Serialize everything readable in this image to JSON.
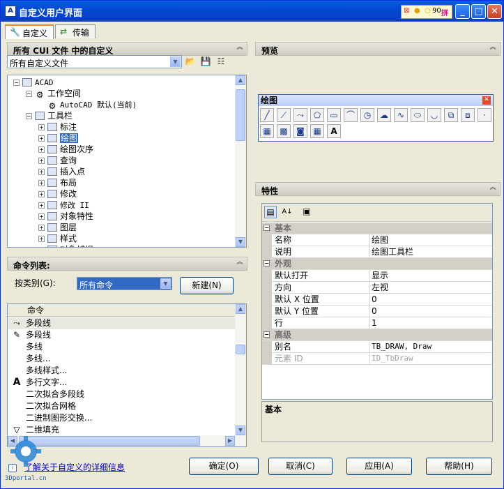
{
  "window": {
    "title": "自定义用户界面",
    "ime_text": "拼",
    "ime_mode": "90"
  },
  "tabs": [
    {
      "label": "自定义"
    },
    {
      "label": "传输"
    }
  ],
  "cui_panel": {
    "title": "所有 CUI 文件 中的自定义",
    "combo_value": "所有自定义文件",
    "tree": [
      {
        "label": "ACAD",
        "level": 0,
        "expanded": true
      },
      {
        "label": "工作空间",
        "level": 1,
        "expanded": true
      },
      {
        "label": "AutoCAD 默认(当前)",
        "level": 2
      },
      {
        "label": "工具栏",
        "level": 1,
        "expanded": true
      },
      {
        "label": "标注",
        "level": 2
      },
      {
        "label": "绘图",
        "level": 2,
        "selected": true
      },
      {
        "label": "绘图次序",
        "level": 2
      },
      {
        "label": "查询",
        "level": 2
      },
      {
        "label": "插入点",
        "level": 2
      },
      {
        "label": "布局",
        "level": 2
      },
      {
        "label": "修改",
        "level": 2
      },
      {
        "label": "修改 II",
        "level": 2
      },
      {
        "label": "对象特性",
        "level": 2
      },
      {
        "label": "图层",
        "level": 2
      },
      {
        "label": "样式",
        "level": 2
      },
      {
        "label": "对象捕捉",
        "level": 2
      }
    ]
  },
  "command_panel": {
    "title": "命令列表:",
    "filter_label": "按类别(G):",
    "filter_value": "所有命令",
    "new_button": "新建(N)",
    "column_header": "命令",
    "commands": [
      {
        "label": "多段线",
        "icon": "polyline-icon",
        "selected": true
      },
      {
        "label": "多段线",
        "icon": "pencil-icon"
      },
      {
        "label": "多线",
        "icon": ""
      },
      {
        "label": "多线...",
        "icon": ""
      },
      {
        "label": "多线样式...",
        "icon": ""
      },
      {
        "label": "多行文字...",
        "icon": "text-A-icon"
      },
      {
        "label": "二次拟合多段线",
        "icon": ""
      },
      {
        "label": "二次拟合网格",
        "icon": ""
      },
      {
        "label": "二进制图形交换...",
        "icon": ""
      },
      {
        "label": "二维填充",
        "icon": "fill-icon"
      }
    ]
  },
  "preview_panel": {
    "title": "预览",
    "toolbar_title": "绘图",
    "tools_row1": [
      "line-icon",
      "ray-icon",
      "polyline-icon",
      "polygon-icon",
      "rectangle-icon",
      "arc-icon",
      "circle-icon",
      "revcloud-icon",
      "spline-icon",
      "ellipse-icon",
      "ellipse-arc-icon",
      "insert-block-icon",
      "make-block-icon",
      "point-icon"
    ],
    "tools_row2": [
      "hatch-icon",
      "gradient-icon",
      "region-icon",
      "table-icon",
      "mtext-icon"
    ]
  },
  "properties_panel": {
    "title": "特性",
    "rows": [
      {
        "type": "category",
        "label": "基本"
      },
      {
        "label": "名称",
        "value": "绘图"
      },
      {
        "label": "说明",
        "value": "绘图工具栏"
      },
      {
        "type": "category",
        "label": "外观"
      },
      {
        "label": "默认打开",
        "value": "显示"
      },
      {
        "label": "方向",
        "value": "左视"
      },
      {
        "label": "默认 X 位置",
        "value": "0"
      },
      {
        "label": "默认 Y 位置",
        "value": "0"
      },
      {
        "label": "行",
        "value": "1"
      },
      {
        "type": "category",
        "label": "高级"
      },
      {
        "label": "别名",
        "value": "TB_DRAW, Draw"
      },
      {
        "label": "元素 ID",
        "value": "ID_TbDraw",
        "disabled": true
      }
    ],
    "description_title": "基本"
  },
  "footer": {
    "help_link": "了解关于自定义的详细信息",
    "ok": "确定(O)",
    "cancel": "取消(C)",
    "apply": "应用(A)",
    "help": "帮助(H)",
    "watermark": "3Dportal.cn"
  }
}
